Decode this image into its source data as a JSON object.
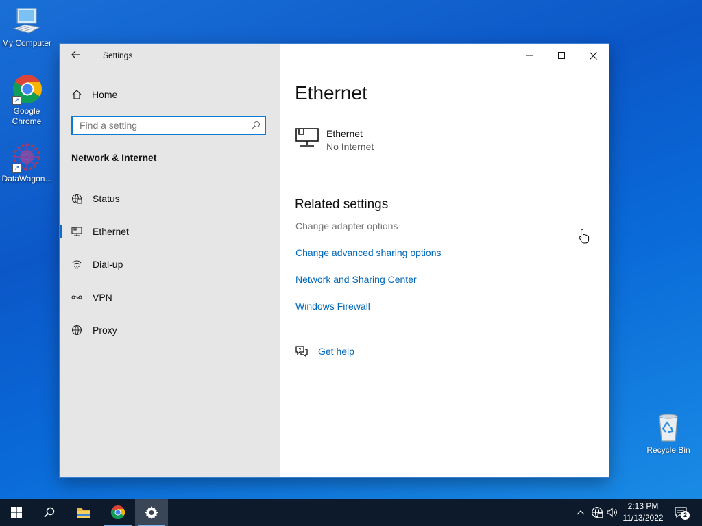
{
  "desktop": {
    "icons": [
      {
        "label": "My Computer"
      },
      {
        "label": "Google Chrome"
      },
      {
        "label": "DataWagon..."
      },
      {
        "label": "Recycle Bin"
      }
    ]
  },
  "window": {
    "title": "Settings",
    "sidebar": {
      "home_label": "Home",
      "search_placeholder": "Find a setting",
      "section_title": "Network & Internet",
      "items": [
        {
          "label": "Status",
          "icon": "globe-status-icon"
        },
        {
          "label": "Ethernet",
          "icon": "ethernet-icon",
          "active": true
        },
        {
          "label": "Dial-up",
          "icon": "dialup-icon"
        },
        {
          "label": "VPN",
          "icon": "vpn-icon"
        },
        {
          "label": "Proxy",
          "icon": "globe-icon"
        }
      ]
    },
    "content": {
      "page_title": "Ethernet",
      "connection_name": "Ethernet",
      "connection_status": "No Internet",
      "related_title": "Related settings",
      "links": [
        {
          "label": "Change adapter options",
          "state": "hover"
        },
        {
          "label": "Change advanced sharing options"
        },
        {
          "label": "Network and Sharing Center"
        },
        {
          "label": "Windows Firewall"
        }
      ],
      "help_label": "Get help"
    }
  },
  "taskbar": {
    "clock_time": "2:13 PM",
    "clock_date": "11/13/2022",
    "notification_count": "2"
  },
  "colors": {
    "accent": "#0c7bd6",
    "link": "#0067b8",
    "sidebar_bg": "#e6e6e6",
    "taskbar_bg": "#0c1a2c"
  }
}
